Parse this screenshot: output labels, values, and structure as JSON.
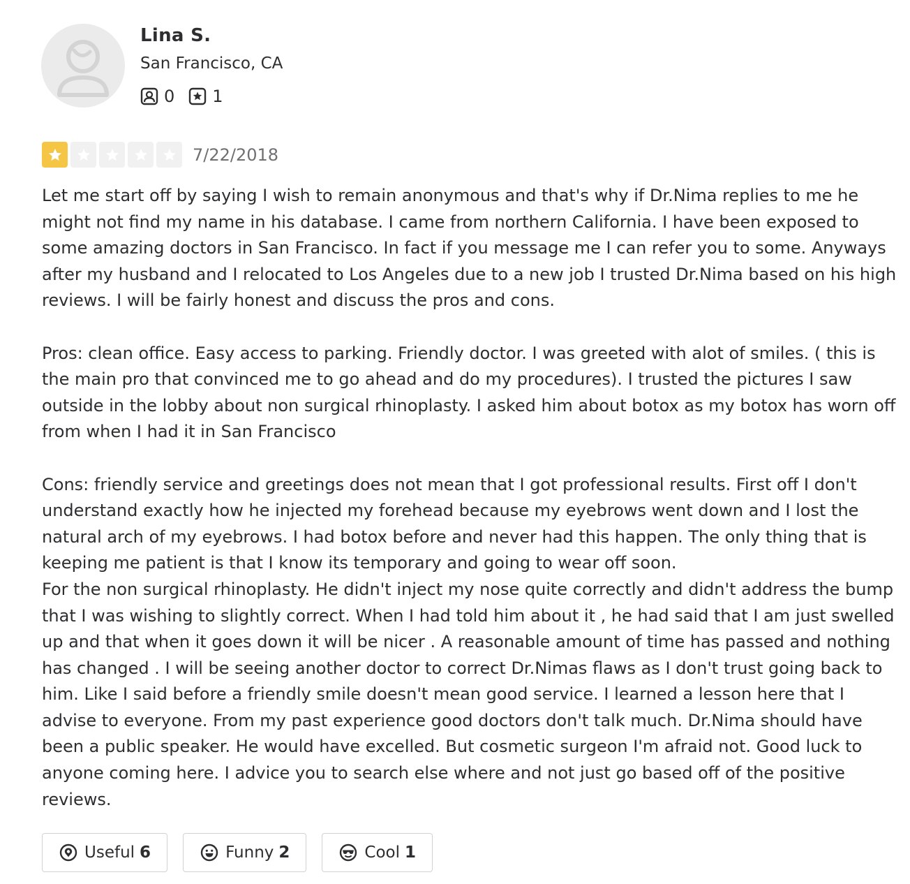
{
  "user": {
    "name": "Lina S.",
    "location": "San Francisco, CA",
    "friends_count": "0",
    "reviews_count": "1",
    "icons": {
      "avatar": "default-user-avatar-icon",
      "friends": "friends-icon",
      "reviews": "reviews-star-icon"
    }
  },
  "review": {
    "rating": 1,
    "max_rating": 5,
    "date": "7/22/2018",
    "paragraphs": [
      "Let me start off by saying I wish to remain anonymous and that's why if Dr.Nima replies to me he might not find my name in his database. I came from northern California. I have been exposed to some amazing doctors in San Francisco. In fact if you message me I can refer you to some. Anyways after my husband and I relocated to Los Angeles due to a new job I trusted Dr.Nima based on his high reviews. I will be fairly honest and discuss the pros and cons.",
      "Pros: clean office. Easy access to parking. Friendly doctor. I was greeted with alot of smiles. ( this is the main pro that convinced me to go ahead and do my procedures). I trusted the pictures I saw outside in the lobby about non surgical rhinoplasty. I asked him about botox as my botox has worn off from when I had it in San Francisco",
      "Cons: friendly service and greetings does not mean that I got professional results. First off I don't understand exactly how he injected my forehead because my eyebrows went down and I lost the natural arch of my eyebrows. I had botox before and never had this happen. The only thing that is keeping me patient is that I know its temporary and going to wear off soon.\nFor the non surgical rhinoplasty. He didn't inject my nose quite correctly and didn't address the bump that I was wishing to slightly correct. When I had told him about it , he had said that I am just swelled up and that when it goes down it will be nicer . A reasonable amount of time has passed and nothing has changed . I will be seeing another doctor to correct Dr.Nimas flaws as I don't trust going back to him.  Like I said before a friendly smile doesn't mean good service. I learned a lesson here that I advise to everyone. From my past experience good doctors don't talk much. Dr.Nima should have been a public speaker. He would have excelled. But cosmetic surgeon I'm afraid not. Good luck to anyone coming here. I advice you to search else where and not just go based off of the positive reviews."
    ]
  },
  "reactions": {
    "useful": {
      "label": "Useful",
      "count": "6",
      "icon": "useful-lightbulb-icon"
    },
    "funny": {
      "label": "Funny",
      "count": "2",
      "icon": "funny-face-icon"
    },
    "cool": {
      "label": "Cool",
      "count": "1",
      "icon": "cool-sunglasses-icon"
    }
  },
  "colors": {
    "star_filled": "#f5c645",
    "star_empty": "#f1f1f1",
    "text": "#2d2e2f",
    "muted": "#6e7072",
    "border": "#d2d2d2"
  }
}
